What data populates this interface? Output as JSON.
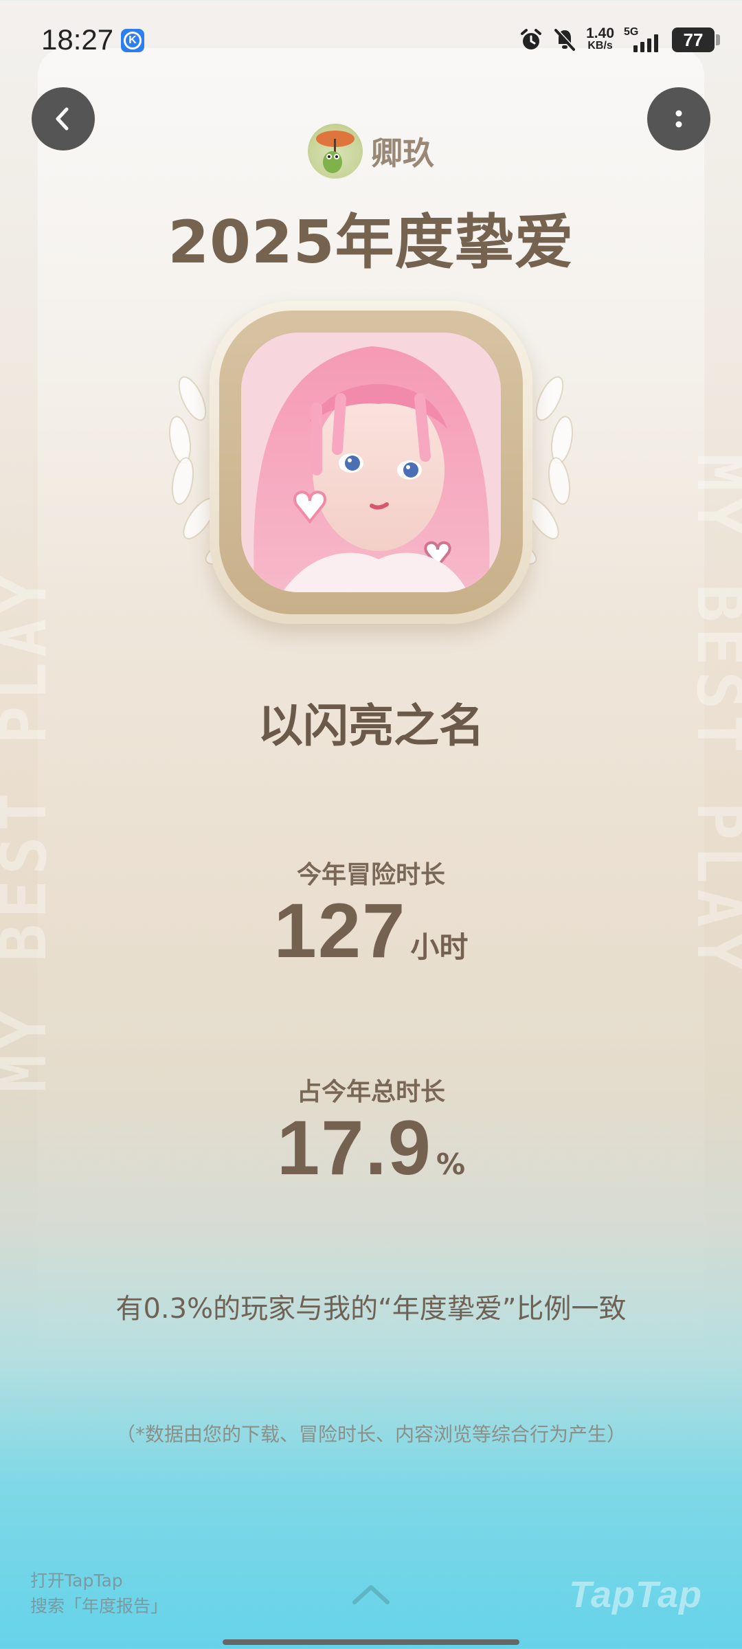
{
  "status_bar": {
    "time": "18:27",
    "app_badge": "K",
    "net_speed_value": "1.40",
    "net_speed_unit": "KB/s",
    "network": "5G",
    "battery": "77"
  },
  "header": {
    "username": "卿玖",
    "title": "2025年度挚爱"
  },
  "game": {
    "name": "以闪亮之名"
  },
  "stats": {
    "playtime_label": "今年冒险时长",
    "playtime_value": "127",
    "playtime_unit": "小时",
    "share_label": "占今年总时长",
    "share_value": "17.9",
    "share_unit": "%"
  },
  "match_text": "有0.3%的玩家与我的“年度挚爱”比例一致",
  "disclaimer": "（*数据由您的下载、冒险时长、内容浏览等综合行为产生）",
  "footer": {
    "hint_line1": "打开TapTap",
    "hint_line2": "搜索「年度报告」",
    "brand": "TapTap"
  },
  "watermark": {
    "left": "MY BEST PLAY",
    "right": "MY BEST PLAY"
  },
  "icons": {
    "back": "chevron-left-icon",
    "more": "more-vertical-icon",
    "swipe": "chevron-up-icon"
  }
}
